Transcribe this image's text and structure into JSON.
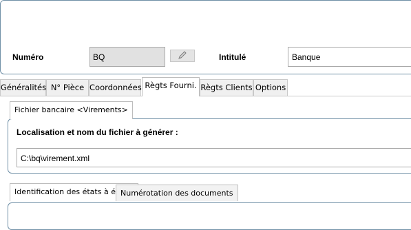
{
  "header": {
    "numero_label": "Numéro",
    "numero_value": "BQ",
    "intitule_label": "Intitulé",
    "intitule_value": "Banque"
  },
  "tabs": [
    {
      "label": "Généralités"
    },
    {
      "label": "N° Pièce"
    },
    {
      "label": "Coordonnées"
    },
    {
      "label": "Règts Fourni.",
      "active": true
    },
    {
      "label": "Règts Clients"
    },
    {
      "label": "Options"
    }
  ],
  "fichier": {
    "tab_label": "Fichier bancaire <Virements>",
    "heading": "Localisation et nom du fichier à générer :",
    "path_value": "C:\\bq\\virement.xml"
  },
  "etats": {
    "tab_identification": "Identification des états à éditer",
    "tab_numerotation": "Numérotation des documents"
  },
  "icons": {
    "edit": "pencil-icon"
  }
}
